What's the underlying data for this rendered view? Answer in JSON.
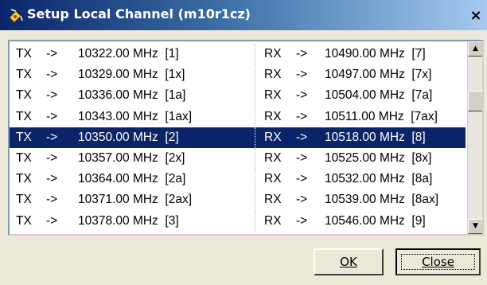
{
  "window": {
    "title": "Setup Local Channel (m10r1cz)",
    "close_glyph": "×"
  },
  "channels": [
    {
      "tx": "TX",
      "tx_arrow": "->",
      "tx_freq": "10322.00 MHz  [1]",
      "rx": "RX",
      "rx_arrow": "->",
      "rx_freq": "10490.00 MHz  [7]",
      "selected": false
    },
    {
      "tx": "TX",
      "tx_arrow": "->",
      "tx_freq": "10329.00 MHz  [1x]",
      "rx": "RX",
      "rx_arrow": "->",
      "rx_freq": "10497.00 MHz  [7x]",
      "selected": false
    },
    {
      "tx": "TX",
      "tx_arrow": "->",
      "tx_freq": "10336.00 MHz  [1a]",
      "rx": "RX",
      "rx_arrow": "->",
      "rx_freq": "10504.00 MHz  [7a]",
      "selected": false
    },
    {
      "tx": "TX",
      "tx_arrow": "->",
      "tx_freq": "10343.00 MHz  [1ax]",
      "rx": "RX",
      "rx_arrow": "->",
      "rx_freq": "10511.00 MHz  [7ax]",
      "selected": false
    },
    {
      "tx": "TX",
      "tx_arrow": "->",
      "tx_freq": "10350.00 MHz  [2]",
      "rx": "RX",
      "rx_arrow": "->",
      "rx_freq": "10518.00 MHz  [8]",
      "selected": true
    },
    {
      "tx": "TX",
      "tx_arrow": "->",
      "tx_freq": "10357.00 MHz  [2x]",
      "rx": "RX",
      "rx_arrow": "->",
      "rx_freq": "10525.00 MHz  [8x]",
      "selected": false
    },
    {
      "tx": "TX",
      "tx_arrow": "->",
      "tx_freq": "10364.00 MHz  [2a]",
      "rx": "RX",
      "rx_arrow": "->",
      "rx_freq": "10532.00 MHz  [8a]",
      "selected": false
    },
    {
      "tx": "TX",
      "tx_arrow": "->",
      "tx_freq": "10371.00 MHz  [2ax]",
      "rx": "RX",
      "rx_arrow": "->",
      "rx_freq": "10539.00 MHz  [8ax]",
      "selected": false
    },
    {
      "tx": "TX",
      "tx_arrow": "->",
      "tx_freq": "10378.00 MHz  [3]",
      "rx": "RX",
      "rx_arrow": "->",
      "rx_freq": "10546.00 MHz  [9]",
      "selected": false
    }
  ],
  "buttons": {
    "ok_label": "OK",
    "close_label": "Close"
  },
  "icons": {
    "app": "satellite-dish-icon",
    "close": "close-icon",
    "scroll_up": "scroll-up-arrow-icon",
    "scroll_down": "scroll-down-arrow-icon"
  },
  "colors": {
    "selection": "#0A246A",
    "title_start": "#0A246A",
    "title_end": "#A6CAF0",
    "face": "#ECE9D8"
  }
}
